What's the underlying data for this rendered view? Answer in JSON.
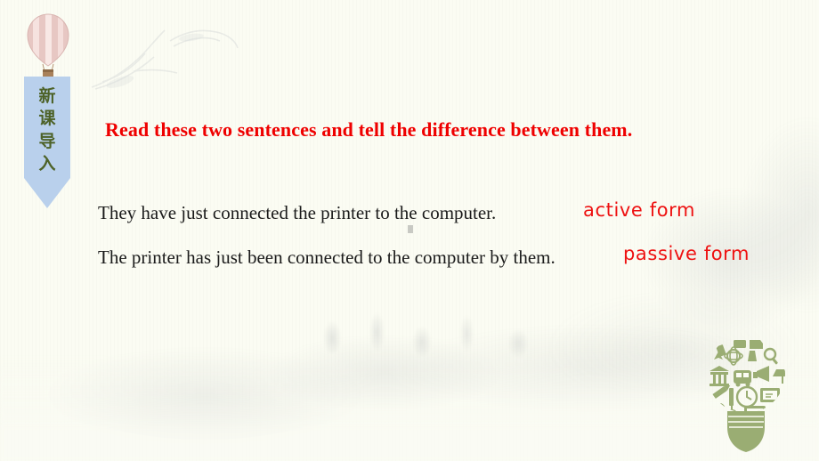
{
  "slide": {
    "background_color": "#fbfcf3",
    "title": "Read these two sentences and tell the difference between them.",
    "title_color": "#ef0000"
  },
  "banner": {
    "name": "new-lesson-introduction",
    "characters": [
      "新",
      "课",
      "导",
      "入"
    ],
    "banner_color": "#b9d0ec",
    "text_color": "#4d6228",
    "balloon_icon": "hot-air-balloon-icon",
    "balloon_color": "#e9ccc8"
  },
  "sentences": [
    {
      "text": "They have just connected the printer to the computer.",
      "label": "active form",
      "label_color": "#ee1111"
    },
    {
      "text": "The printer has just been connected to the computer by them.",
      "label": "passive form",
      "label_color": "#ee1111"
    }
  ],
  "decorations": {
    "idea_bulb_icon": "idea-lightbulb-icon",
    "idea_bulb_color": "#9aad73",
    "crane_watermark_icon": "crane-ink-wash-watermark",
    "mountain_watermark_icon": "mountain-ink-wash-watermark"
  }
}
